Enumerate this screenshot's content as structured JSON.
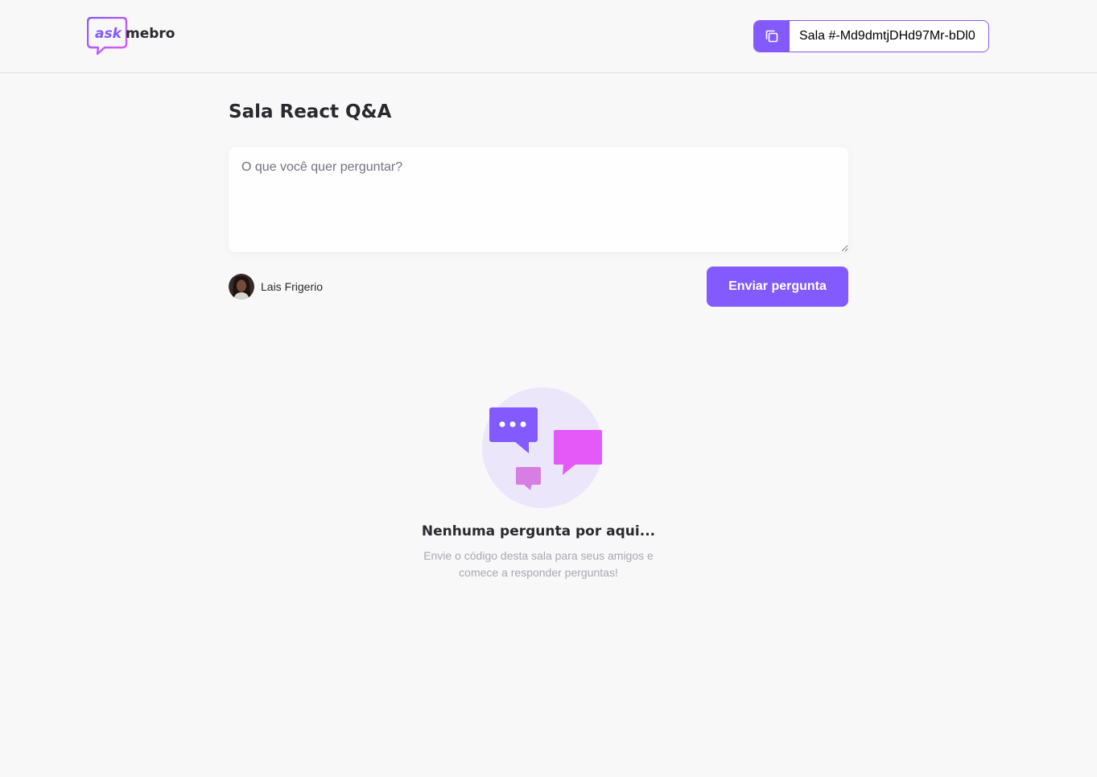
{
  "header": {
    "logo": {
      "part1": "ask",
      "part2": "mebro"
    },
    "room_code": {
      "label": "Sala #-Md9dmtjDHd97Mr-bDl0"
    }
  },
  "main": {
    "room_title": "Sala React Q&A",
    "question_input": {
      "placeholder": "O que você quer perguntar?",
      "value": ""
    },
    "user": {
      "name": "Lais Frigerio"
    },
    "send_button_label": "Enviar pergunta",
    "empty_state": {
      "title": "Nenhuma pergunta por aqui...",
      "description": "Envie o código desta sala para seus amigos e comece a responder perguntas!"
    }
  },
  "colors": {
    "accent": "#835afd",
    "pink": "#e559f9",
    "background": "#f8f8f8",
    "text": "#29292e",
    "muted": "#a8a8b3"
  },
  "icons": {
    "copy": "copy-icon",
    "logo": "ask-mebro-logo",
    "empty": "chat-bubbles-illustration"
  }
}
